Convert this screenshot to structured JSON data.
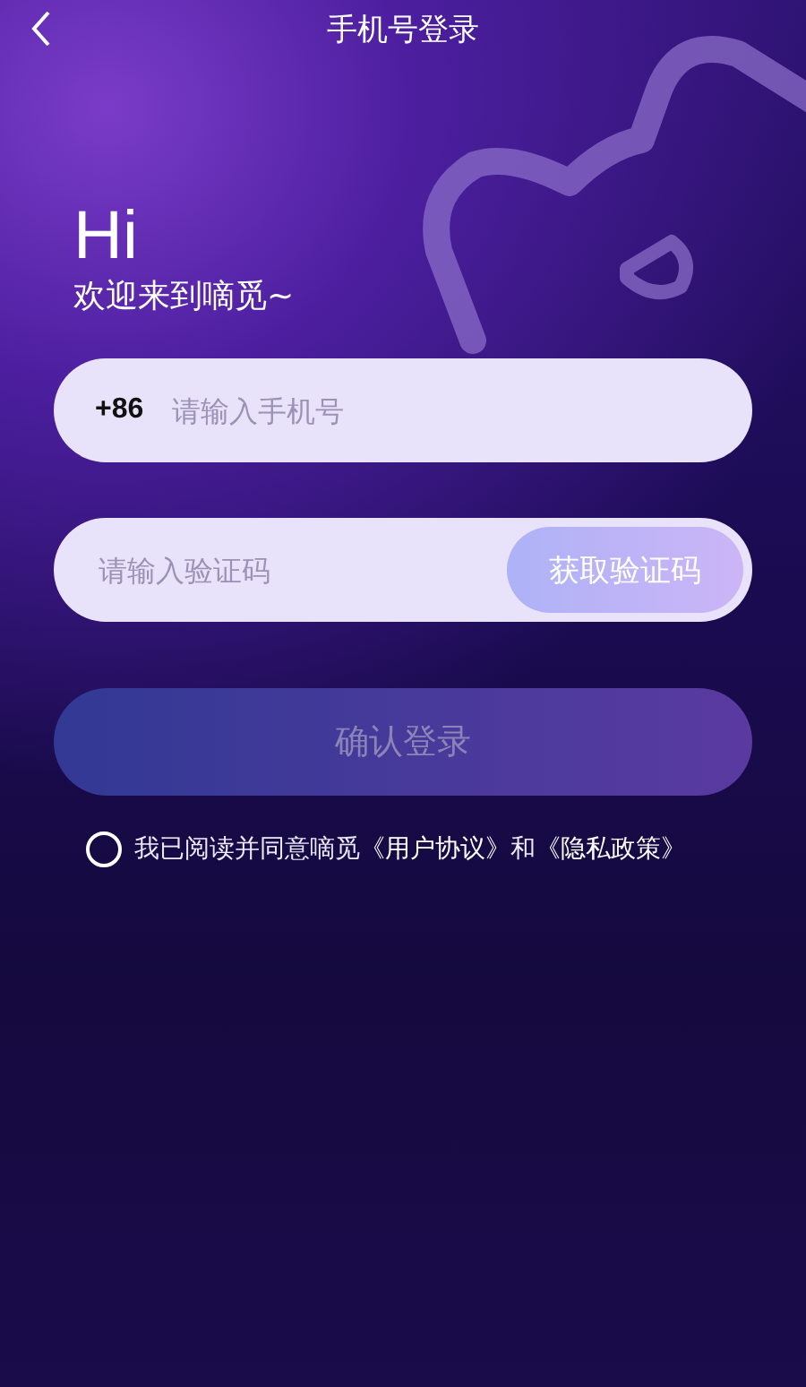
{
  "header": {
    "title": "手机号登录"
  },
  "greeting": {
    "title": "Hi",
    "subtitle": "欢迎来到嘀觅~"
  },
  "phone_field": {
    "country_code": "+86",
    "placeholder": "请输入手机号"
  },
  "code_field": {
    "placeholder": "请输入验证码",
    "button": "获取验证码"
  },
  "login_button": {
    "label": "确认登录",
    "disabled": true
  },
  "agreement": {
    "checked": false,
    "parts": [
      {
        "kind": "text",
        "text": "我已阅读并同意嘀觅"
      },
      {
        "kind": "link",
        "text": "《用户协议》"
      },
      {
        "kind": "text",
        "text": "和"
      },
      {
        "kind": "link",
        "text": "《隐私政策》"
      }
    ]
  }
}
